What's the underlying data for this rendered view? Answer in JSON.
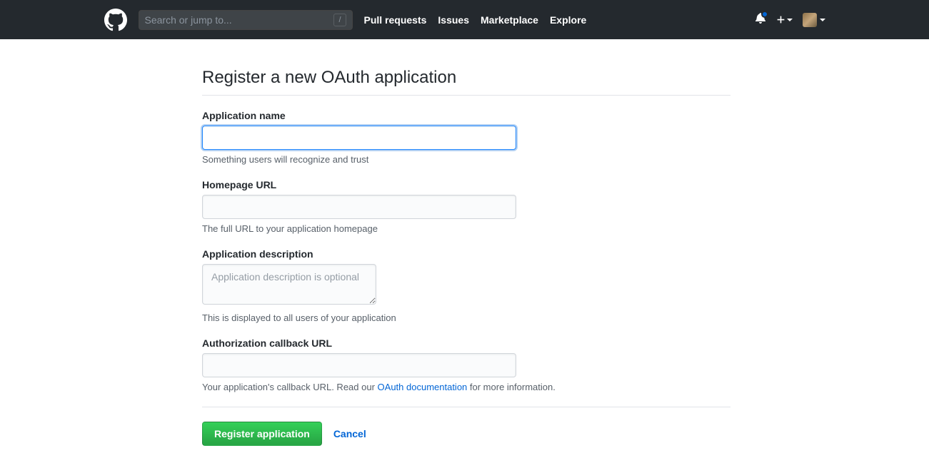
{
  "header": {
    "search_placeholder": "Search or jump to...",
    "nav": {
      "pull_requests": "Pull requests",
      "issues": "Issues",
      "marketplace": "Marketplace",
      "explore": "Explore"
    }
  },
  "page": {
    "title": "Register a new OAuth application"
  },
  "form": {
    "app_name": {
      "label": "Application name",
      "value": "",
      "help": "Something users will recognize and trust"
    },
    "homepage": {
      "label": "Homepage URL",
      "value": "",
      "help": "The full URL to your application homepage"
    },
    "description": {
      "label": "Application description",
      "placeholder": "Application description is optional",
      "value": "",
      "help": "This is displayed to all users of your application"
    },
    "callback": {
      "label": "Authorization callback URL",
      "value": "",
      "help_pre": "Your application's callback URL. Read our ",
      "help_link": "OAuth documentation",
      "help_post": " for more information."
    },
    "actions": {
      "submit": "Register application",
      "cancel": "Cancel"
    }
  }
}
